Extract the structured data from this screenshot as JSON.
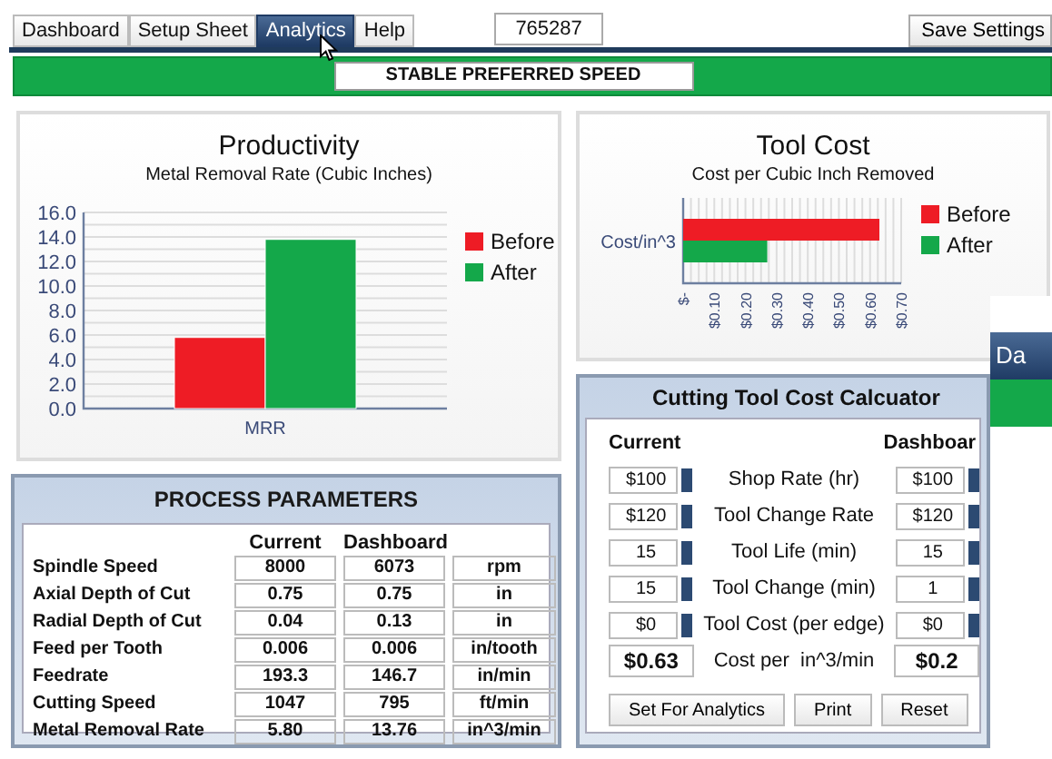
{
  "tabs": [
    {
      "label": "Dashboard",
      "selected": false
    },
    {
      "label": "Setup Sheet",
      "selected": false
    },
    {
      "label": "Analytics",
      "selected": true
    },
    {
      "label": "Help",
      "selected": false
    }
  ],
  "job_number": "765287",
  "save_button": "Save Settings",
  "status_banner": "STABLE PREFERRED SPEED",
  "productivity": {
    "title": "Productivity",
    "subtitle": "Metal Removal Rate (Cubic Inches)",
    "chart_data": {
      "type": "bar",
      "categories": [
        "MRR"
      ],
      "series": [
        {
          "name": "Before",
          "color": "#ee1c25",
          "values": [
            5.8
          ]
        },
        {
          "name": "After",
          "color": "#14a84a",
          "values": [
            13.8
          ]
        }
      ],
      "ylim": [
        0,
        16
      ],
      "grid": true,
      "yticks": [
        {
          "value": 0,
          "label": "0.0"
        },
        {
          "value": 2,
          "label": "2.0"
        },
        {
          "value": 4,
          "label": "4.0"
        },
        {
          "value": 6,
          "label": "6.0"
        },
        {
          "value": 8,
          "label": "8.0"
        },
        {
          "value": 10,
          "label": "10.0"
        },
        {
          "value": 12,
          "label": "12.0"
        },
        {
          "value": 14,
          "label": "14.0"
        },
        {
          "value": 16,
          "label": "16.0"
        }
      ]
    }
  },
  "tool_cost": {
    "title": "Tool Cost",
    "subtitle": "Cost per Cubic Inch Removed",
    "chart_data": {
      "type": "bar",
      "orientation": "horizontal",
      "categories": [
        "Cost/in^3"
      ],
      "series": [
        {
          "name": "Before",
          "color": "#ee1c25",
          "values": [
            0.63
          ]
        },
        {
          "name": "After",
          "color": "#14a84a",
          "values": [
            0.27
          ]
        }
      ],
      "xlim": [
        0,
        0.7
      ],
      "grid": true,
      "xticks": [
        {
          "value": 0,
          "label": "$-"
        },
        {
          "value": 0.1,
          "label": "$0.10"
        },
        {
          "value": 0.2,
          "label": "$0.20"
        },
        {
          "value": 0.3,
          "label": "$0.30"
        },
        {
          "value": 0.4,
          "label": "$0.40"
        },
        {
          "value": 0.5,
          "label": "$0.50"
        },
        {
          "value": 0.6,
          "label": "$0.60"
        },
        {
          "value": 0.7,
          "label": "$0.70"
        }
      ]
    }
  },
  "process_parameters": {
    "title": "PROCESS PARAMETERS",
    "columns": [
      "Current",
      "Dashboard"
    ],
    "rows": [
      {
        "label": "Spindle Speed",
        "current": "8000",
        "dashboard": "6073",
        "unit": "rpm"
      },
      {
        "label": "Axial Depth of Cut",
        "current": "0.75",
        "dashboard": "0.75",
        "unit": "in"
      },
      {
        "label": "Radial Depth of Cut",
        "current": "0.04",
        "dashboard": "0.13",
        "unit": "in"
      },
      {
        "label": "Feed per Tooth",
        "current": "0.006",
        "dashboard": "0.006",
        "unit": "in/tooth"
      },
      {
        "label": "Feedrate",
        "current": "193.3",
        "dashboard": "146.7",
        "unit": "in/min"
      },
      {
        "label": "Cutting Speed",
        "current": "1047",
        "dashboard": "795",
        "unit": "ft/min"
      },
      {
        "label": "Metal Removal Rate",
        "current": "5.80",
        "dashboard": "13.76",
        "unit": "in^3/min"
      }
    ]
  },
  "calculator": {
    "title": "Cutting Tool Cost Calcuator",
    "columns": [
      "Current",
      "Dashboar"
    ],
    "rows": [
      {
        "label": "Shop Rate (hr)",
        "current": "$100",
        "dashboard": "$100"
      },
      {
        "label": "Tool Change Rate",
        "current": "$120",
        "dashboard": "$120"
      },
      {
        "label": "Tool Life (min)",
        "current": "15",
        "dashboard": "15"
      },
      {
        "label": "Tool Change (min)",
        "current": "15",
        "dashboard": "1"
      },
      {
        "label": "Tool Cost (per edge)",
        "current": "$0",
        "dashboard": "$0"
      }
    ],
    "result": {
      "label": "Cost per  in^3/min",
      "current": "$0.63",
      "dashboard": "$0.2"
    },
    "buttons": [
      "Set For Analytics",
      "Print",
      "Reset"
    ]
  },
  "overlay_window": {
    "title": "Da"
  }
}
